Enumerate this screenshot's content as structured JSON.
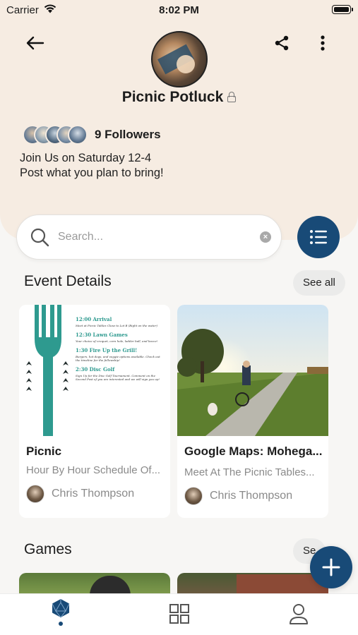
{
  "status_bar": {
    "carrier": "Carrier",
    "time": "8:02 PM"
  },
  "group": {
    "name": "Picnic Potluck",
    "followers": "9 Followers",
    "description_line1": "Join Us on Saturday 12-4",
    "description_line2": "Post what you plan to bring!"
  },
  "search": {
    "placeholder": "Search..."
  },
  "sections": {
    "event_details": {
      "title": "Event Details",
      "see_all": "See all"
    },
    "games": {
      "title": "Games",
      "see_all_partial": "Se"
    }
  },
  "cards": [
    {
      "title": "Picnic",
      "subtitle": "Hour By Hour Schedule Of...",
      "author": "Chris Thompson",
      "schedule": [
        {
          "time": "12:00 Arrival",
          "note": "Meet at Picnic Tables Close to Lot B (Right on the water)"
        },
        {
          "time": "12:30 Lawn Games",
          "note": "Your choice of croquet, corn hole, ladder ball, and bocce!"
        },
        {
          "time": "1:30 Fire Up the Grill!",
          "note": "Burgers, hot dogs, and veggie options available. Check out the timeline for the fellowship!"
        },
        {
          "time": "2:30 Disc Golf",
          "note": "Sign Up for the Disc Golf Tournament. Comment on the Second Post of you are interested and we will sign you up!"
        }
      ]
    },
    {
      "title": "Google Maps: Mohega...",
      "subtitle": "Meet At The Picnic Tables...",
      "author": "Chris Thompson"
    }
  ],
  "icons": {
    "back": "arrow-left-icon",
    "share": "share-icon",
    "more": "more-vertical-icon",
    "lock": "lock-icon",
    "search": "search-icon",
    "clear": "clear-icon",
    "list": "list-icon",
    "add": "plus-icon",
    "tabs": [
      "polyhedron-icon",
      "grid-icon",
      "user-icon"
    ]
  },
  "colors": {
    "accent": "#184a77",
    "header_bg": "#f6ece2",
    "teal": "#2e9a8f"
  }
}
